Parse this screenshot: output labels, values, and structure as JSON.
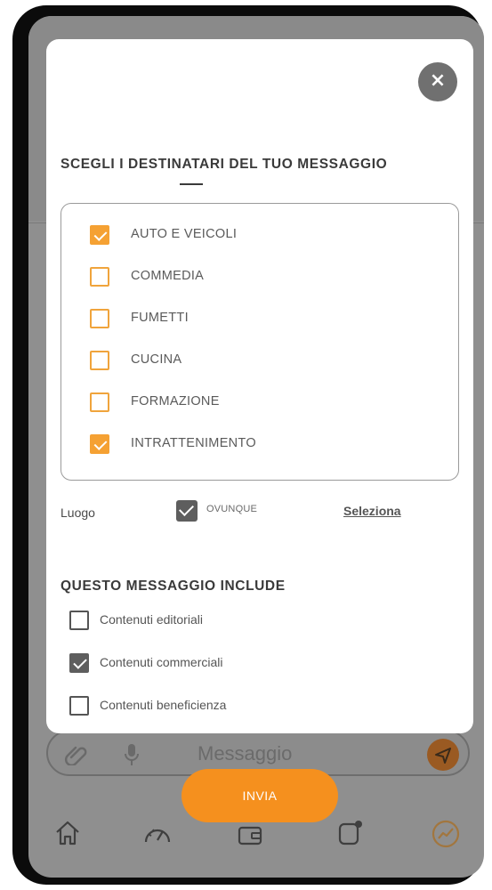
{
  "modal": {
    "close_symbol": "×",
    "recipients_title": "SCEGLI I DESTINATARI DEL TUO MESSAGGIO",
    "categories": [
      {
        "label": "AUTO E VEICOLI",
        "checked": true
      },
      {
        "label": "COMMEDIA",
        "checked": false
      },
      {
        "label": "FUMETTI",
        "checked": false
      },
      {
        "label": "CUCINA",
        "checked": false
      },
      {
        "label": "FORMAZIONE",
        "checked": false
      },
      {
        "label": "INTRATTENIMENTO",
        "checked": true
      }
    ],
    "place": {
      "label": "Luogo",
      "value": "OVUNQUE",
      "checked": true,
      "select_label": "Seleziona"
    },
    "includes_title": "QUESTO MESSAGGIO INCLUDE",
    "includes": [
      {
        "label": "Contenuti editoriali",
        "checked": false
      },
      {
        "label": "Contenuti commerciali",
        "checked": true
      },
      {
        "label": "Contenuti beneficienza",
        "checked": false
      }
    ]
  },
  "message_bar": {
    "placeholder": "Messaggio"
  },
  "send_button": {
    "label": "INVIA"
  },
  "icons": [
    "close-icon",
    "paperclip-icon",
    "microphone-icon",
    "send-icon",
    "home-icon",
    "speedometer-icon",
    "wallet-icon",
    "notification-icon",
    "trending-icon"
  ],
  "colors": {
    "accent": "#f5901e",
    "checkbox_orange": "#f5a133",
    "overlay": "#8f8f8f"
  }
}
